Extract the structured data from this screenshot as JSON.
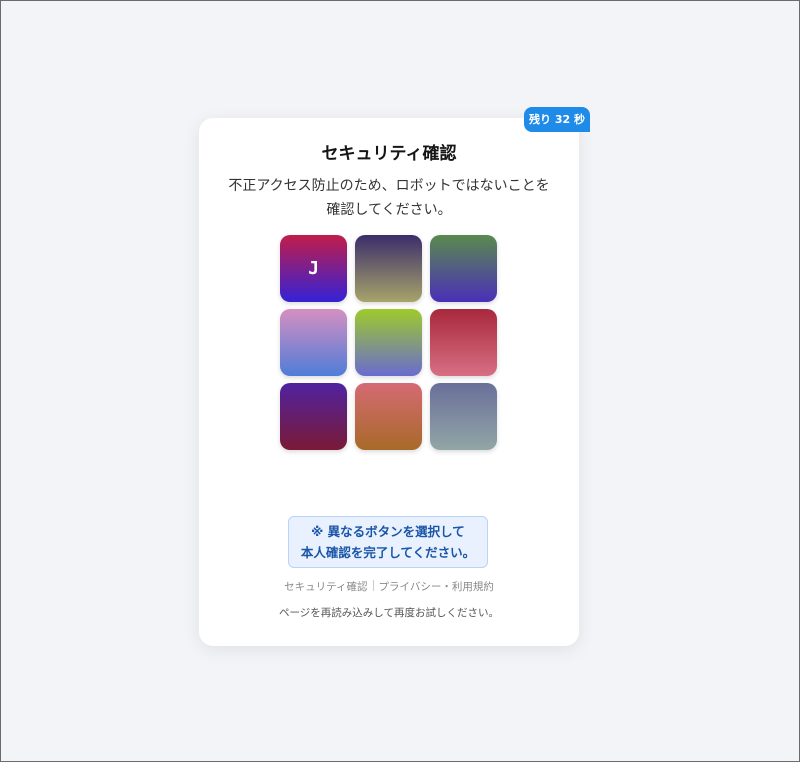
{
  "timer": {
    "label": "残り 32 秒"
  },
  "card": {
    "title": "セキュリティ確認",
    "description_line1": "不正アクセス防止のため、ロボットではないことを",
    "description_line2": "確認してください。"
  },
  "tiles": [
    {
      "letter": "J",
      "gradient": [
        "#c11d4a",
        "#3422d6"
      ]
    },
    {
      "letter": "",
      "gradient": [
        "#3b2d6b",
        "#a7a46a"
      ]
    },
    {
      "letter": "",
      "gradient": [
        "#5a8a4e",
        "#4a2fb8"
      ]
    },
    {
      "letter": "",
      "gradient": [
        "#d58fc1",
        "#4f7dd8"
      ]
    },
    {
      "letter": "",
      "gradient": [
        "#9ecb2a",
        "#6a6bd0"
      ]
    },
    {
      "letter": "",
      "gradient": [
        "#a8283c",
        "#d86f84"
      ]
    },
    {
      "letter": "",
      "gradient": [
        "#5022a0",
        "#7a1a36"
      ]
    },
    {
      "letter": "",
      "gradient": [
        "#d56a74",
        "#a86a28"
      ]
    },
    {
      "letter": "",
      "gradient": [
        "#6a6f9a",
        "#92a6a6"
      ]
    }
  ],
  "notice": {
    "line1": "※ 異なるボタンを選択して",
    "line2": "本人確認を完了してください。"
  },
  "footer": {
    "link1": "セキュリティ確認",
    "link2": "プライバシー・利用規約",
    "reload": "ページを再読み込みして再度お試しください。"
  },
  "colors": {
    "accent": "#1f8be8",
    "notice_bg": "#e8f1fd",
    "notice_text": "#1a55a8"
  }
}
